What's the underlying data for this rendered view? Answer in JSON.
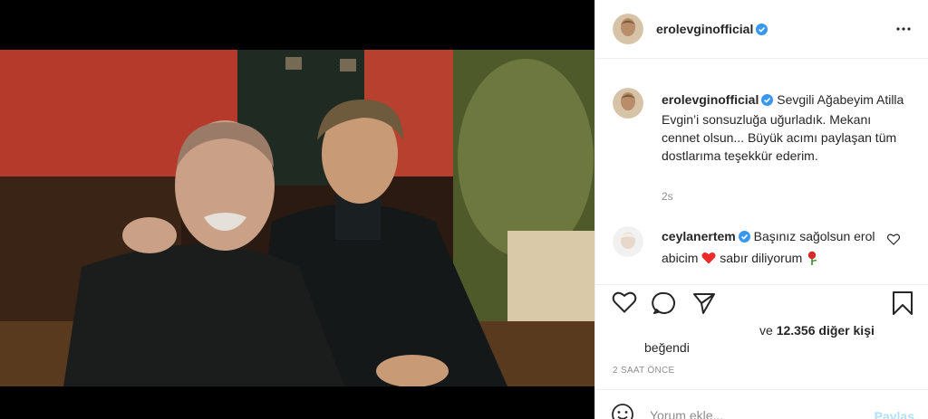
{
  "post": {
    "username": "erolevginofficial",
    "more_icon": "more-dots-icon"
  },
  "caption": {
    "username": "erolevginofficial",
    "text": "Sevgili Ağabeyim Atilla Evgin’i sonsuzluğa uğurladık. Mekanı cennet olsun... Büyük acımı paylaşan tüm dostlarıma teşekkür ederim.",
    "time": "2s"
  },
  "comment": {
    "username": "ceylanertem",
    "text_before": "Başınız sağolsun erol abicim",
    "text_after": "sabır diliyorum"
  },
  "likes": {
    "prefix": "ve",
    "count_text": "12.356 diğer kişi",
    "liked_label": "beğendi"
  },
  "timestamp": "2 SAAT ÖNCE",
  "add_comment": {
    "placeholder": "Yorum ekle...",
    "post_label": "Paylaş"
  },
  "colors": {
    "verified": "#3897f0",
    "link_disabled": "#b2dffc",
    "heart": "#ed4956"
  }
}
